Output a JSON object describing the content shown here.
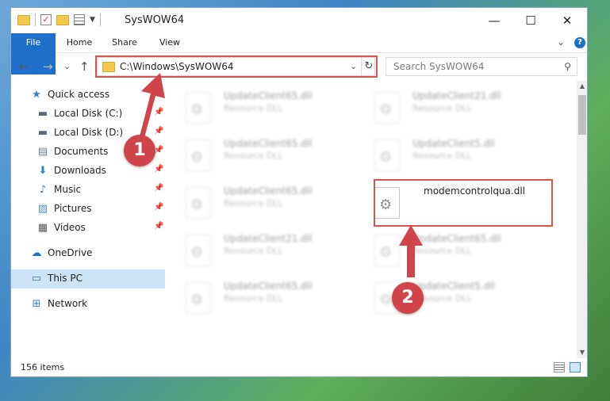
{
  "window": {
    "title": "SysWOW64"
  },
  "titlebar": {
    "minimize": "—",
    "maximize": "☐",
    "close": "✕"
  },
  "ribbon": {
    "tabs": [
      "File",
      "Home",
      "Share",
      "View"
    ],
    "expand": "⌄",
    "help": "?"
  },
  "nav": {
    "back": "←",
    "forward": "→",
    "recent": "⌄",
    "up": "↑"
  },
  "address": {
    "path": "C:\\Windows\\SysWOW64",
    "dropdown": "⌄",
    "refresh": "↻"
  },
  "search": {
    "placeholder": "Search SysWOW64",
    "icon": "⚲"
  },
  "sidebar": {
    "items": [
      {
        "label": "Quick access",
        "icon": "★",
        "color": "#2e7fd0"
      },
      {
        "label": "Local Disk (C:)",
        "icon": "▬",
        "color": "#5a6b7b",
        "pin": "📌"
      },
      {
        "label": "Local Disk (D:)",
        "icon": "▬",
        "color": "#5a6b7b",
        "pin": "📌"
      },
      {
        "label": "Documents",
        "icon": "▤",
        "color": "#6b7f93",
        "pin": "📌"
      },
      {
        "label": "Downloads",
        "icon": "⬇",
        "color": "#2e7fd0",
        "pin": "📌"
      },
      {
        "label": "Music",
        "icon": "♪",
        "color": "#2e7fd0",
        "pin": "📌"
      },
      {
        "label": "Pictures",
        "icon": "▨",
        "color": "#4e8bbf",
        "pin": "📌"
      },
      {
        "label": "Videos",
        "icon": "▦",
        "color": "#555555",
        "pin": "📌"
      },
      {
        "label": "OneDrive",
        "icon": "☁",
        "color": "#1e6fc7"
      },
      {
        "label": "This PC",
        "icon": "▭",
        "color": "#3d7fc0"
      },
      {
        "label": "Network",
        "icon": "⊞",
        "color": "#3d7fc0"
      }
    ]
  },
  "files": [
    {
      "name": "UpdateClient65.dll",
      "type": "Resource DLL"
    },
    {
      "name": "UpdateClient21.dll",
      "type": "Resource DLL"
    },
    {
      "name": "UpdateClient65.dll",
      "type": "Resource DLL"
    },
    {
      "name": "UpdateClient5.dll",
      "type": "Resource DLL"
    },
    {
      "name": "UpdateClient65.dll",
      "type": "Resource DLL"
    },
    {
      "name": "modemcontrolqua.dll",
      "type": ""
    },
    {
      "name": "UpdateClient21.dll",
      "type": "Resource DLL"
    },
    {
      "name": "UpdateClient65.dll",
      "type": "Resource DLL"
    },
    {
      "name": "UpdateClient65.dll",
      "type": "Resource DLL"
    },
    {
      "name": "UpdateClient5.dll",
      "type": "Resource DLL"
    }
  ],
  "status": {
    "items": "156 items"
  },
  "callouts": {
    "one": "1",
    "two": "2",
    "color": "#d0454a"
  }
}
